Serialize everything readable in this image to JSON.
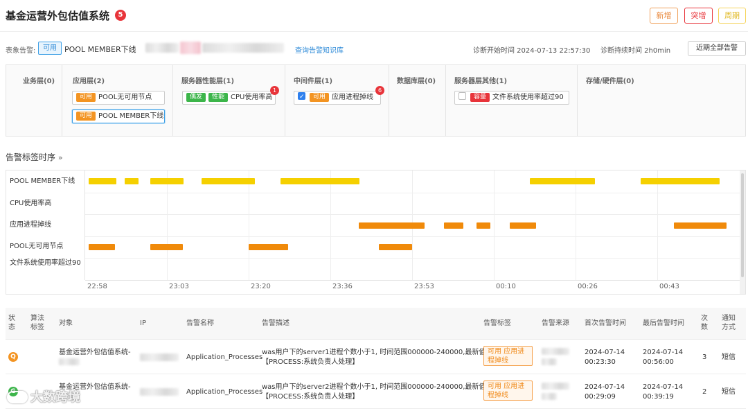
{
  "header": {
    "title": "基金运营外包估值系统",
    "badge": "5",
    "buttons": {
      "new": "新增",
      "burst": "突增",
      "cycle": "周期"
    }
  },
  "alarm_bar": {
    "label": "表象告警:",
    "status": "可用",
    "name": "POOL MEMBER下线",
    "kb_link": "查询告警知识库",
    "start_time": "诊断开始时间 2024-07-13 22:57:30",
    "duration": "诊断持续时间 2h0min",
    "all_alarms_button": "近期全部告警"
  },
  "layers": [
    {
      "title": "业务层(0)",
      "items": []
    },
    {
      "title": "应用层(2)",
      "items": [
        {
          "tags": [
            {
              "text": "可用",
              "color": "orange"
            }
          ],
          "label": "POOL无可用节点",
          "active": false
        },
        {
          "tags": [
            {
              "text": "可用",
              "color": "orange"
            }
          ],
          "label": "POOL MEMBER下线",
          "active": true
        }
      ]
    },
    {
      "title": "服务器性能层(1)",
      "items": [
        {
          "tags": [
            {
              "text": "偶发",
              "color": "green"
            },
            {
              "text": "性能",
              "color": "green"
            }
          ],
          "label": "CPU使用率高",
          "count": "1"
        }
      ]
    },
    {
      "title": "中间件层(1)",
      "items": [
        {
          "checked": true,
          "tags": [
            {
              "text": "可用",
              "color": "orange"
            }
          ],
          "label": "应用进程掉线",
          "count": "6"
        }
      ]
    },
    {
      "title": "数据库层(0)",
      "items": []
    },
    {
      "title": "服务器层其他(1)",
      "items": [
        {
          "checked": false,
          "tags": [
            {
              "text": "容量",
              "color": "red"
            }
          ],
          "label": "文件系统使用率超过90"
        }
      ]
    },
    {
      "title": "存储/硬件层(0)",
      "items": []
    }
  ],
  "timeline": {
    "section_title": "告警标签时序",
    "section_arrow": "»",
    "rows": [
      "POOL MEMBER下线",
      "CPU使用率高",
      "应用进程掉线",
      "POOL无可用节点",
      "文件系统使用率超过90"
    ],
    "ticks": [
      "22:58",
      "23:03",
      "23:20",
      "23:36",
      "23:53",
      "00:10",
      "00:26",
      "00:43"
    ],
    "bars": [
      {
        "row": 0,
        "start": 0.005,
        "end": 0.047,
        "color": "yellow"
      },
      {
        "row": 0,
        "start": 0.06,
        "end": 0.081,
        "color": "yellow"
      },
      {
        "row": 0,
        "start": 0.099,
        "end": 0.15,
        "color": "yellow"
      },
      {
        "row": 0,
        "start": 0.178,
        "end": 0.259,
        "color": "yellow"
      },
      {
        "row": 0,
        "start": 0.298,
        "end": 0.418,
        "color": "yellow"
      },
      {
        "row": 0,
        "start": 0.679,
        "end": 0.778,
        "color": "yellow"
      },
      {
        "row": 0,
        "start": 0.848,
        "end": 0.969,
        "color": "yellow"
      },
      {
        "row": 2,
        "start": 0.418,
        "end": 0.518,
        "color": "orange"
      },
      {
        "row": 2,
        "start": 0.548,
        "end": 0.578,
        "color": "orange"
      },
      {
        "row": 2,
        "start": 0.597,
        "end": 0.618,
        "color": "orange"
      },
      {
        "row": 2,
        "start": 0.648,
        "end": 0.688,
        "color": "orange"
      },
      {
        "row": 2,
        "start": 0.898,
        "end": 0.978,
        "color": "orange"
      },
      {
        "row": 3,
        "start": 0.005,
        "end": 0.045,
        "color": "orange"
      },
      {
        "row": 3,
        "start": 0.099,
        "end": 0.149,
        "color": "orange"
      },
      {
        "row": 3,
        "start": 0.249,
        "end": 0.309,
        "color": "orange"
      },
      {
        "row": 3,
        "start": 0.448,
        "end": 0.499,
        "color": "orange"
      }
    ]
  },
  "table": {
    "headers": [
      "状态",
      "算法标签",
      "对象",
      "IP",
      "告警名称",
      "告警描述",
      "告警标签",
      "告警来源",
      "首次告警时间",
      "最后告警时间",
      "次数",
      "通知方式"
    ],
    "rows": [
      {
        "status": "Q",
        "status_color": "orange",
        "object": "基金运营外包估值系统-",
        "name": "Application_Processes",
        "desc1": "was用户下的server1进程个数小于1, 时间范围000000-240000,最新值0,",
        "desc2": "【PROCESS:系统负责人处理】",
        "tag": "可用 应用进程掉线",
        "first1": "2024-07-14",
        "first2": "00:23:30",
        "last1": "2024-07-14",
        "last2": "00:56:00",
        "count": "3",
        "notify": "短信"
      },
      {
        "status": "G",
        "status_color": "green",
        "object": "基金运营外包估值系统-",
        "name": "Application_Processes",
        "desc1": "was用户下的server2进程个数小于1, 时间范围000000-240000,最新值0,",
        "desc2": "【PROCESS:系统负责人处理】",
        "tag": "可用 应用进程掉线",
        "first1": "2024-07-14",
        "first2": "00:29:09",
        "last1": "2024-07-14",
        "last2": "00:39:19",
        "count": "2",
        "notify": "短信"
      }
    ]
  },
  "watermark": "大数跨境"
}
